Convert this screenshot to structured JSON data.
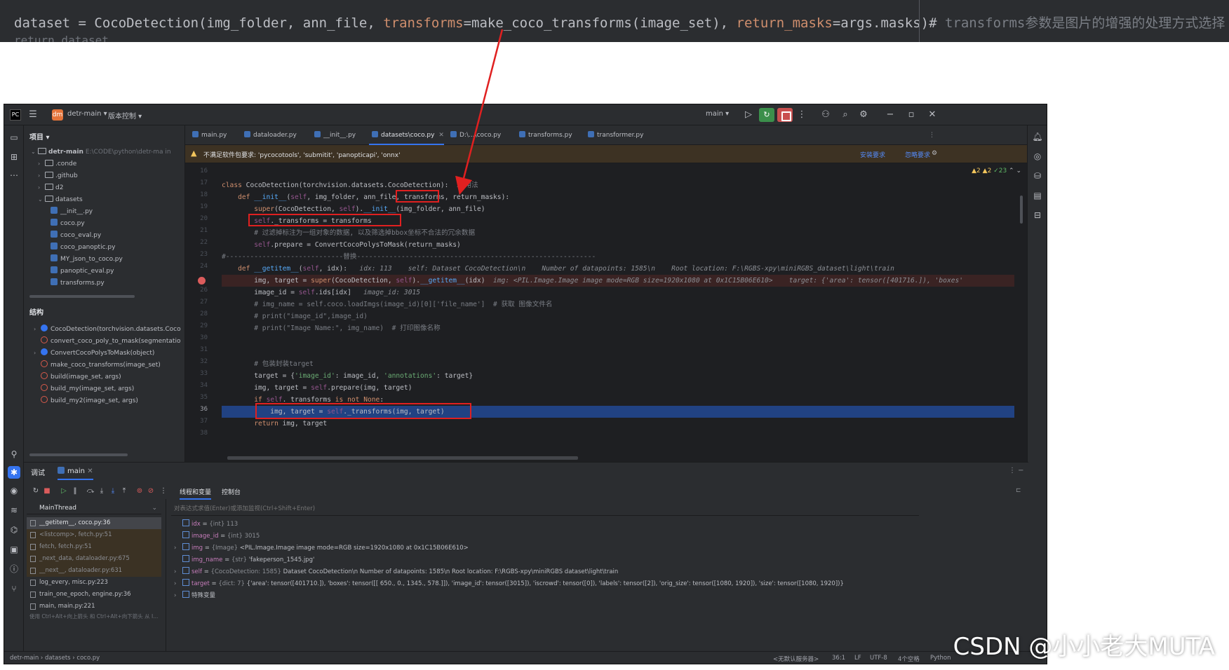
{
  "top_snippet": {
    "prefix": "dataset = CocoDetection(img_folder, ann_file, ",
    "kw1": "transforms",
    "mid1": "=make_coco_transforms(image_set), ",
    "kw2": "return_masks",
    "mid2": "=args.masks)#",
    "comment": " transforms参数是图片的增强的处理方式选择",
    "next_line": "return dataset"
  },
  "titlebar": {
    "project_name": "detr-main",
    "vcs_menu": "版本控制",
    "branch": "main"
  },
  "project_panel": {
    "title": "项目",
    "root_name": "detr-main",
    "root_path": "E:\\CODE\\python\\detr-ma in",
    "items": [
      ".conde",
      ".github",
      "d2",
      "datasets",
      "__init__.py",
      "coco.py",
      "coco_eval.py",
      "coco_panoptic.py",
      "MY_json_to_coco.py",
      "panoptic_eval.py",
      "transforms.py"
    ]
  },
  "structure_panel": {
    "title": "结构",
    "items": [
      {
        "label": "CocoDetection(torchvision.datasets.Coco",
        "kind": "class"
      },
      {
        "label": "convert_coco_poly_to_mask(segmentatio",
        "kind": "fn"
      },
      {
        "label": "ConvertCocoPolysToMask(object)",
        "kind": "class"
      },
      {
        "label": "make_coco_transforms(image_set)",
        "kind": "fn"
      },
      {
        "label": "build(image_set, args)",
        "kind": "fn"
      },
      {
        "label": "build_my(image_set, args)",
        "kind": "fn"
      },
      {
        "label": "build_my2(image_set, args)",
        "kind": "fn"
      }
    ]
  },
  "editor": {
    "tabs": [
      "main.py",
      "dataloader.py",
      "__init__.py",
      "datasets\\coco.py",
      "D:\\...\\coco.py",
      "transforms.py",
      "transformer.py"
    ],
    "active_tab": "datasets\\coco.py",
    "warning": "不满足软件包要求: 'pycocotools', 'submitit', 'panopticapi', 'onnx'",
    "warning_action1": "安装要求",
    "warning_action2": "忽略要求",
    "inspections": {
      "warn1": "▲2",
      "warn2": "▲2",
      "ok": "✓23"
    },
    "line_numbers": [
      "16",
      "17",
      "18",
      "19",
      "20",
      "21",
      "22",
      "23",
      "24",
      "25",
      "26",
      "27",
      "28",
      "29",
      "30",
      "31",
      "32",
      "33",
      "34",
      "35",
      "36",
      "37",
      "38"
    ],
    "usages": "5 用法",
    "section_comment": "#-----------------------------替换-----------------------------------------------------------",
    "line_getitem_hint": "idx: 113    self: Dataset CocoDetection\\n    Number of datapoints: 1585\\n    Root location: F:\\RGBS-xpy\\miniRGBS_dataset\\light\\train",
    "line_super_hint": "img: <PIL.Image.Image image mode=RGB size=1920x1080 at 0x1C15B06E610>    target: {'area': tensor([401716.]), 'boxes'",
    "image_id_hint": "image_id: 3015",
    "comment_filter": "# 过滤掉标注为一组对象的数据, 以及筛选掉bbox坐标不合法的冗余数据",
    "comment_get_name": "# 获取 图像文件名",
    "comment_print_name": "# 打印图像名称",
    "comment_pack": "# 包装封装target"
  },
  "debug": {
    "tool_title": "调试",
    "run_tab": "main",
    "sub_tabs": [
      "线程和变量",
      "控制台"
    ],
    "thread": "MainThread",
    "frames": [
      {
        "label": "__getitem__, coco.py:36",
        "kind": "sel"
      },
      {
        "label": "<listcomp>, fetch.py:51",
        "kind": "lib"
      },
      {
        "label": "fetch, fetch.py:51",
        "kind": "lib"
      },
      {
        "label": "_next_data, dataloader.py:675",
        "kind": "lib"
      },
      {
        "label": "__next__, dataloader.py:631",
        "kind": "lib"
      },
      {
        "label": "log_every, misc.py:223",
        "kind": "normal"
      },
      {
        "label": "train_one_epoch, engine.py:36",
        "kind": "normal"
      },
      {
        "label": "main, main.py:221",
        "kind": "normal"
      }
    ],
    "frames_hint": "使用 Ctrl+Alt+向上箭头 和 Ctrl+Alt+向下箭头 从 I...",
    "eval_placeholder": "对表达式求值(Enter)或添加监视(Ctrl+Shift+Enter)",
    "variables": [
      {
        "name": "idx",
        "type": "{int} 113",
        "value": "",
        "expand": false
      },
      {
        "name": "image_id",
        "type": "{int} 3015",
        "value": "",
        "expand": false
      },
      {
        "name": "img",
        "type": "{Image}",
        "value": "<PIL.Image.Image image mode=RGB size=1920x1080 at 0x1C15B06E610>",
        "expand": true
      },
      {
        "name": "img_name",
        "type": "{str}",
        "value": "'fakeperson_1545.jpg'",
        "expand": false
      },
      {
        "name": "self",
        "type": "{CocoDetection: 1585}",
        "value": "Dataset CocoDetection\\n    Number of datapoints: 1585\\n    Root location: F:\\RGBS-xpy\\miniRGBS dataset\\light\\train",
        "expand": true
      },
      {
        "name": "target",
        "type": "{dict: 7}",
        "value": "{'area': tensor([401710.]), 'boxes': tensor([[ 650.,   0., 1345., 578.]]), 'image_id': tensor([3015]), 'iscrowd': tensor([0]), 'labels': tensor([2]), 'orig_size': tensor([1080, 1920]), 'size': tensor([1080, 1920])}",
        "expand": true
      },
      {
        "name": "特殊变量",
        "type": "",
        "value": "",
        "expand": true
      }
    ]
  },
  "statusbar": {
    "breadcrumb": [
      "detr-main",
      "datasets",
      "coco.py"
    ],
    "interpreter": "<无默认服务器>",
    "position": "36:1",
    "line_sep": "LF",
    "encoding": "UTF-8",
    "indent": "4个空格",
    "python": "Python"
  },
  "watermark": "CSDN @小小老大MUTA",
  "colors": {
    "accent": "#3574f0",
    "annotation_red": "#e02020",
    "breakpoint": "#db5c5c"
  }
}
